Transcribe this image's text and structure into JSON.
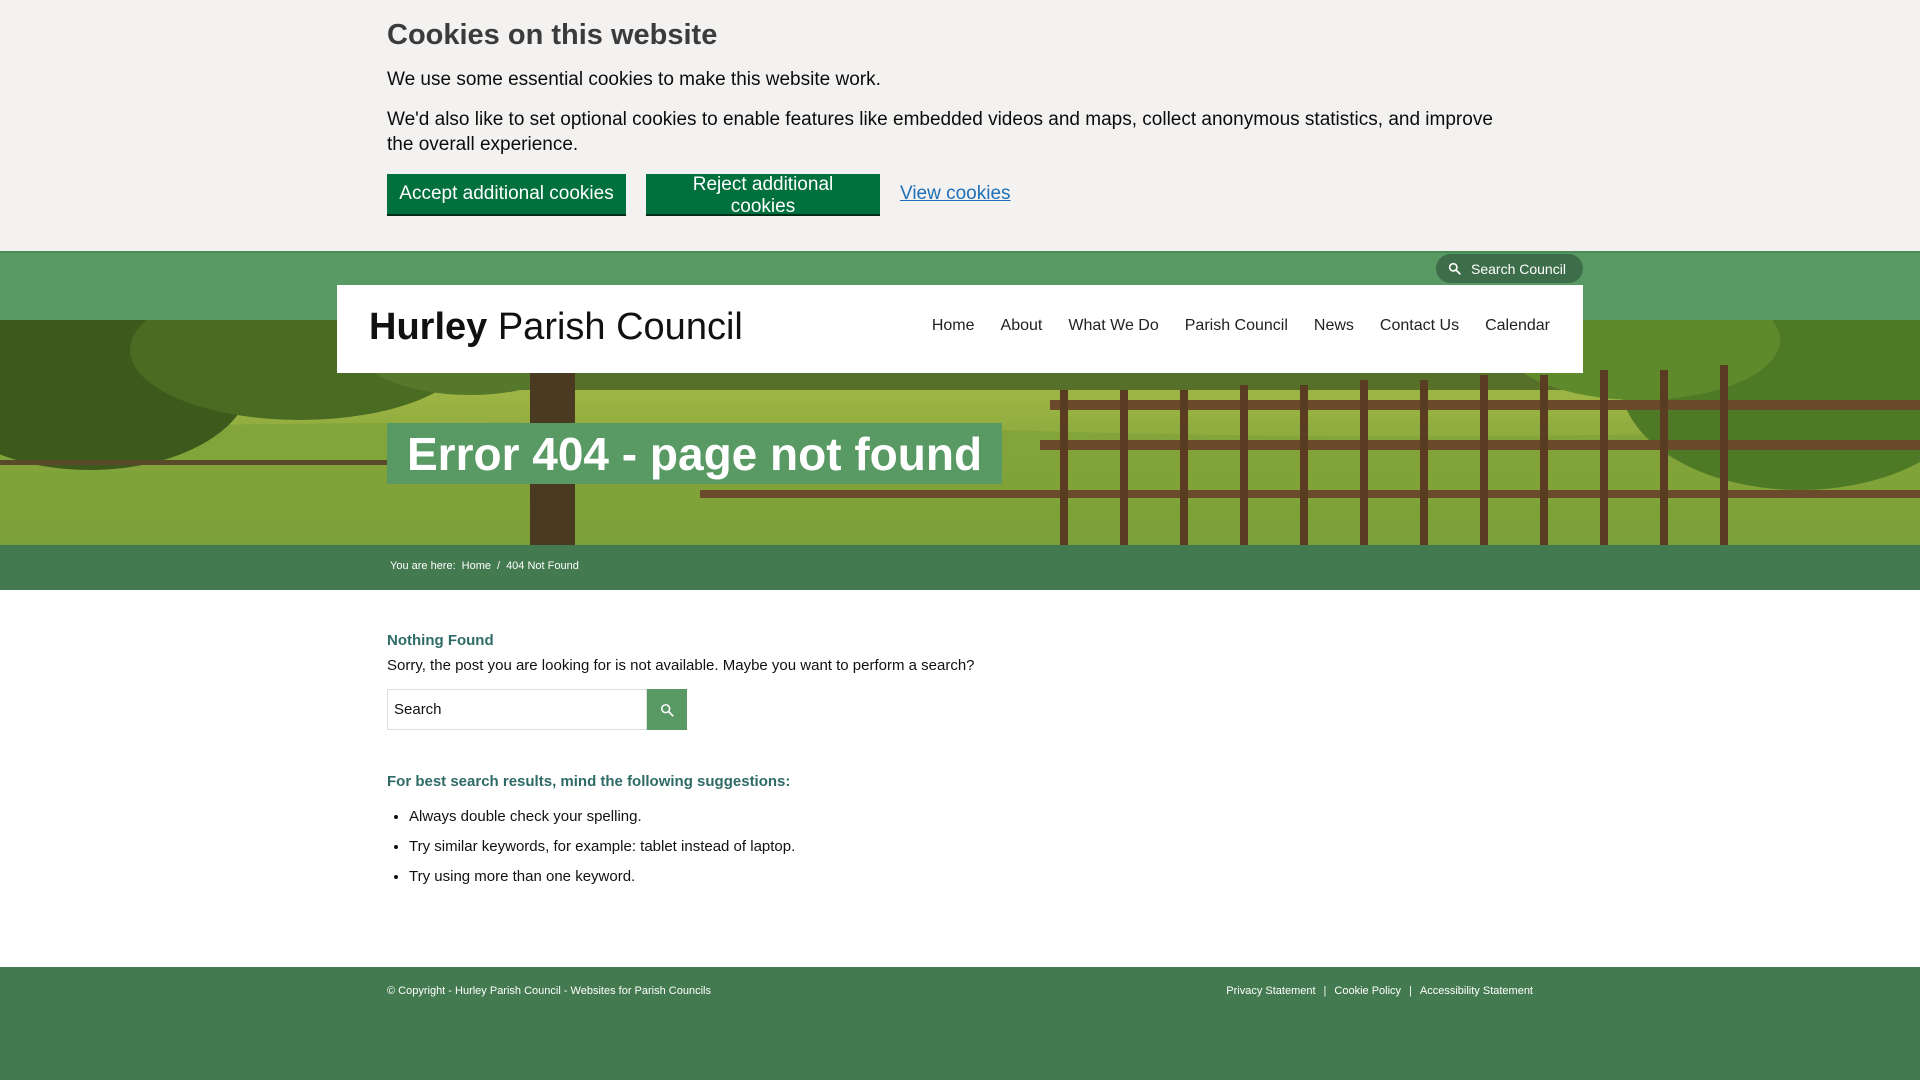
{
  "cookie_banner": {
    "title": "Cookies on this website",
    "text1": "We use some essential cookies to make this website work.",
    "text2": "We'd also like to set optional cookies to enable features like embedded videos and maps, collect anonymous statistics, and improve the overall experience.",
    "accept_label": "Accept additional cookies",
    "reject_label": "Reject additional cookies",
    "view_label": "View cookies"
  },
  "header": {
    "search_council_label": "Search Council",
    "logo_bold": "Hurley",
    "logo_rest": " Parish Council",
    "nav": [
      "Home",
      "About",
      "What We Do",
      "Parish Council",
      "News",
      "Contact Us",
      "Calendar"
    ]
  },
  "page_title": "Error 404 - page not found",
  "breadcrumb": {
    "prefix": "You are here:",
    "home": "Home",
    "separator": "/",
    "current": "404 Not Found"
  },
  "main": {
    "nothing_found": "Nothing Found",
    "sorry": "Sorry, the post you are looking for is not available. Maybe you want to perform a search?",
    "search_value": "Search",
    "suggest_title": "For best search results, mind the following suggestions:",
    "suggestions": [
      "Always double check your spelling.",
      "Try similar keywords, for example: tablet instead of laptop.",
      "Try using more than one keyword."
    ]
  },
  "footer": {
    "copyright": "© Copyright - Hurley Parish Council - Websites for Parish Councils",
    "links": [
      "Privacy Statement",
      "Cookie Policy",
      "Accessibility Statement"
    ],
    "separator": "|"
  },
  "colors": {
    "brand_green": "#589964",
    "dark_green": "#447a50",
    "gov_green": "#00703c",
    "link_blue": "#1d70b8",
    "teal_heading": "#2e6b66"
  },
  "icons": {
    "search": "search-icon"
  }
}
